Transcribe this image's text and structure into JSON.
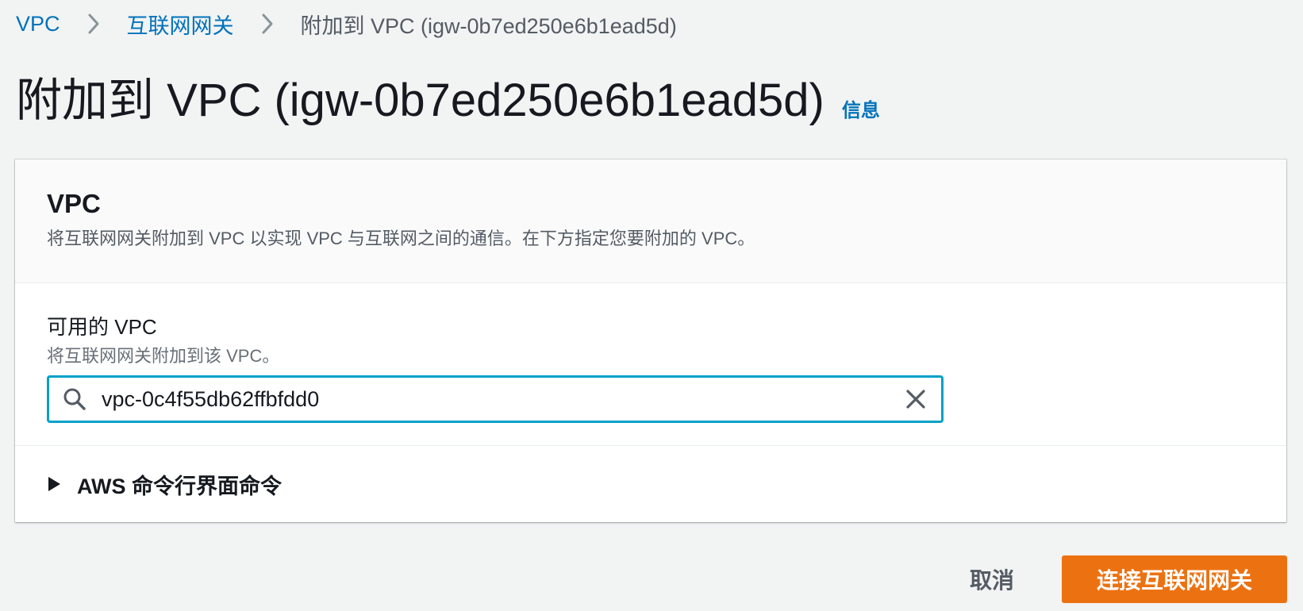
{
  "breadcrumb": {
    "items": [
      {
        "label": "VPC"
      },
      {
        "label": "互联网网关"
      }
    ],
    "current": "附加到 VPC (igw-0b7ed250e6b1ead5d)"
  },
  "header": {
    "title": "附加到 VPC (igw-0b7ed250e6b1ead5d)",
    "info_label": "信息"
  },
  "panel": {
    "title": "VPC",
    "description": "将互联网网关附加到 VPC 以实现 VPC 与互联网之间的通信。在下方指定您要附加的 VPC。",
    "field": {
      "label": "可用的 VPC",
      "description": "将互联网网关附加到该 VPC。",
      "value": "vpc-0c4f55db62ffbfdd0"
    },
    "expander": {
      "label": "AWS 命令行界面命令"
    }
  },
  "actions": {
    "cancel_label": "取消",
    "submit_label": "连接互联网网关"
  },
  "colors": {
    "link": "#0073bb",
    "focus_border": "#00a1c9",
    "primary": "#ec7211",
    "background": "#f2f3f3"
  },
  "icons": {
    "breadcrumb_separator": "chevron-right-icon",
    "search": "search-icon",
    "clear": "close-icon",
    "expander": "caret-right-icon"
  }
}
